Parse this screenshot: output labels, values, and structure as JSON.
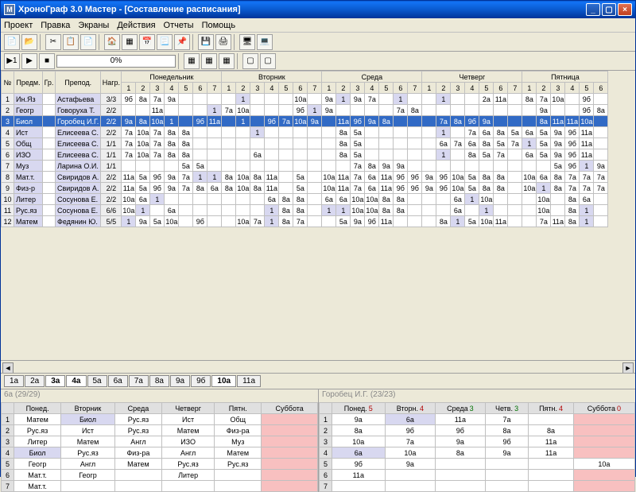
{
  "title": "ХроноГраф 3.0 Мастер - [Составление расписания]",
  "titleIcon": "M",
  "menu": [
    "Проект",
    "Правка",
    "Экраны",
    "Действия",
    "Отчеты",
    "Помощь"
  ],
  "progress": "0%",
  "columns": {
    "num": "№",
    "subj": "Предм.",
    "grp": "Гр.",
    "teach": "Препод.",
    "load": "Нагр."
  },
  "days": [
    "Понедельник",
    "Вторник",
    "Среда",
    "Четверг",
    "Пятница"
  ],
  "periods": {
    "mon": 7,
    "tue": 7,
    "wed": 7,
    "thu": 7,
    "fri": 6
  },
  "rows": [
    {
      "n": 1,
      "s": "Ин.Яз",
      "t": "Астафьева",
      "l": "3/3",
      "cells": {
        "m1": "9б",
        "m2": "8а",
        "m3": "7а",
        "m4": "9а",
        "v2": "1",
        "v6": "10а",
        "w1": "9а",
        "w2": "1",
        "w3": "9а",
        "w4": "7а",
        "w6": "1",
        "th2": "1",
        "th5": "2а",
        "th6": "11а",
        "f1": "8а",
        "f2": "7а",
        "f3": "10а",
        "f5": "9б"
      }
    },
    {
      "n": 2,
      "s": "Геогр",
      "t": "Говоруха Т.",
      "l": "2/2",
      "cells": {
        "m3": "11а",
        "m7": "1",
        "v1": "7а",
        "v2": "10а",
        "v6": "9б",
        "v7": "1",
        "w1": "9а",
        "w6": "7а",
        "w7": "8а",
        "f2": "9а",
        "f5": "9б",
        "f6": "8а"
      }
    },
    {
      "n": 3,
      "s": "Биол",
      "t": "Горобец И.Г.",
      "l": "2/2",
      "sel": true,
      "cells": {
        "m1": "9а",
        "m2": "8а",
        "m3": "10а",
        "m4": "1",
        "m6": "9б",
        "m7": "11а",
        "v2": "1",
        "v4": "9б",
        "v5": "7а",
        "v6": "10а",
        "v7": "9а",
        "w2": "11а",
        "w3": "9б",
        "w4": "9а",
        "w5": "8а",
        "th2": "7а",
        "th3": "8а",
        "th4": "9б",
        "th5": "9а",
        "f2": "8а",
        "f3": "11а",
        "f4": "11а",
        "f5": "10а"
      }
    },
    {
      "n": 4,
      "s": "Ист",
      "t": "Елисеева С.",
      "l": "2/2",
      "cells": {
        "m1": "7а",
        "m2": "10а",
        "m3": "7а",
        "m4": "8а",
        "m5": "8а",
        "v3": "1",
        "w2": "8а",
        "w3": "5а",
        "th2": "1",
        "th4": "7а",
        "th5": "6а",
        "th6": "8а",
        "th7": "5а",
        "f1": "6а",
        "f2": "5а",
        "f3": "9а",
        "f4": "9б",
        "f5": "11а"
      }
    },
    {
      "n": 5,
      "s": "Общ",
      "t": "Елисеева С.",
      "l": "1/1",
      "cells": {
        "m1": "7а",
        "m2": "10а",
        "m3": "7а",
        "m4": "8а",
        "m5": "8а",
        "w2": "8а",
        "w3": "5а",
        "th2": "6а",
        "th3": "7а",
        "th4": "6а",
        "th5": "8а",
        "th6": "5а",
        "th7": "7а",
        "f1": "1",
        "f2": "5а",
        "f3": "9а",
        "f4": "9б",
        "f5": "11а"
      }
    },
    {
      "n": 6,
      "s": "ИЗО",
      "t": "Елисеева С.",
      "l": "1/1",
      "cells": {
        "m1": "7а",
        "m2": "10а",
        "m3": "7а",
        "m4": "8а",
        "m5": "8а",
        "v3": "6а",
        "w2": "8а",
        "w3": "5а",
        "th2": "1",
        "th4": "8а",
        "th5": "5а",
        "th6": "7а",
        "f1": "6а",
        "f2": "5а",
        "f3": "9а",
        "f4": "9б",
        "f5": "11а"
      }
    },
    {
      "n": 7,
      "s": "Муз",
      "t": "Ларина О.И.",
      "l": "1/1",
      "cells": {
        "m5": "5а",
        "m6": "5а",
        "w3": "7а",
        "w4": "8а",
        "w5": "9а",
        "w6": "9а",
        "f3": "5а",
        "f4": "9б",
        "f5": "1",
        "f6": "9а"
      }
    },
    {
      "n": 8,
      "s": "Мат.т.",
      "t": "Свиридов А.",
      "l": "2/2",
      "cells": {
        "m1": "11а",
        "m2": "5а",
        "m3": "9б",
        "m4": "9а",
        "m5": "7а",
        "m6": "1",
        "m7": "1",
        "v1": "8а",
        "v2": "10а",
        "v3": "8а",
        "v4": "11а",
        "v6": "5а",
        "w1": "10а",
        "w2": "11а",
        "w3": "7а",
        "w4": "6а",
        "w5": "11а",
        "w6": "9б",
        "w7": "9б",
        "th1": "9а",
        "th2": "9б",
        "th3": "10а",
        "th4": "5а",
        "th5": "8а",
        "th6": "8а",
        "f1": "10а",
        "f2": "6а",
        "f3": "8а",
        "f4": "7а",
        "f5": "7а",
        "f6": "7а"
      }
    },
    {
      "n": 9,
      "s": "Физ-р",
      "t": "Свиридов А.",
      "l": "2/2",
      "cells": {
        "m1": "11а",
        "m2": "5а",
        "m3": "9б",
        "m4": "9а",
        "m5": "7а",
        "m6": "8а",
        "m7": "6а",
        "v1": "8а",
        "v2": "10а",
        "v3": "8а",
        "v4": "11а",
        "v6": "5а",
        "w1": "10а",
        "w2": "11а",
        "w3": "7а",
        "w4": "6а",
        "w5": "11а",
        "w6": "9б",
        "w7": "9б",
        "th1": "9а",
        "th2": "9б",
        "th3": "10а",
        "th4": "5а",
        "th5": "8а",
        "th6": "8а",
        "f1": "10а",
        "f2": "1",
        "f3": "8а",
        "f4": "7а",
        "f5": "7а",
        "f6": "7а"
      }
    },
    {
      "n": 10,
      "s": "Литер",
      "t": "Сосунова Е.",
      "l": "2/2",
      "cells": {
        "m1": "10а",
        "m2": "6а",
        "m3": "1",
        "v4": "6а",
        "v5": "8а",
        "v6": "8а",
        "w1": "6а",
        "w2": "6а",
        "w3": "10а",
        "w4": "10а",
        "w5": "8а",
        "w6": "8а",
        "th3": "6а",
        "th4": "1",
        "th5": "10а",
        "f2": "10а",
        "f4": "8а",
        "f5": "6а"
      }
    },
    {
      "n": 11,
      "s": "Рус.яз",
      "t": "Сосунова Е.",
      "l": "6/6",
      "cells": {
        "m1": "10а",
        "m2": "1",
        "m4": "6а",
        "v4": "1",
        "v5": "8а",
        "v6": "8а",
        "w1": "1",
        "w2": "1",
        "w3": "10а",
        "w4": "10а",
        "w5": "8а",
        "w6": "8а",
        "th3": "6а",
        "th5": "1",
        "f2": "10а",
        "f4": "8а",
        "f5": "1"
      }
    },
    {
      "n": 12,
      "s": "Матем",
      "t": "Федянин Ю.",
      "l": "5/5",
      "cells": {
        "m1": "1",
        "m2": "9а",
        "m3": "5а",
        "m4": "10а",
        "m6": "9б",
        "v2": "10а",
        "v3": "7а",
        "v4": "1",
        "v5": "8а",
        "v6": "7а",
        "w2": "5а",
        "w3": "9а",
        "w4": "9б",
        "w5": "11а",
        "th2": "8а",
        "th3": "1",
        "th4": "5а",
        "th5": "10а",
        "th6": "11а",
        "f2": "7а",
        "f3": "11а",
        "f4": "8а",
        "f5": "1"
      }
    }
  ],
  "tabs": [
    "1а",
    "2а",
    "3а",
    "4а",
    "5а",
    "6а",
    "7а",
    "8а",
    "9а",
    "9б",
    "10а",
    "11а"
  ],
  "activeTabs": [
    "3а",
    "4а",
    "10а"
  ],
  "leftPane": {
    "label": "6а (29/29)",
    "headers": [
      "Понед.",
      "Вторник",
      "Среда",
      "Четверг",
      "Пятн.",
      "Суббота"
    ],
    "rows": [
      {
        "n": "1",
        "c": [
          "Матем",
          "Биол",
          "Рус.яз",
          "Ист",
          "Общ",
          ""
        ]
      },
      {
        "n": "2",
        "c": [
          "Рус.яз",
          "Ист",
          "Рус.яз",
          "Матем",
          "Физ-ра",
          ""
        ]
      },
      {
        "n": "3",
        "c": [
          "Литер",
          "Матем",
          "Англ",
          "ИЗО",
          "Муз",
          ""
        ]
      },
      {
        "n": "4",
        "c": [
          "Биол",
          "Рус.яз",
          "Физ-ра",
          "Англ",
          "Матем",
          ""
        ]
      },
      {
        "n": "5",
        "c": [
          "Геогр",
          "Англ",
          "Матем",
          "Рус.яз",
          "Рус.яз",
          ""
        ]
      },
      {
        "n": "6",
        "c": [
          "Мат.т.",
          "Геогр",
          "",
          "Литер",
          "",
          ""
        ]
      },
      {
        "n": "7",
        "c": [
          "Мат.т.",
          "",
          "",
          "",
          "",
          ""
        ]
      }
    ]
  },
  "rightPane": {
    "label": "Горобец И.Г. (23/23)",
    "headers": [
      {
        "t": "Понед.",
        "n": "5"
      },
      {
        "t": "Вторн.",
        "n": "4"
      },
      {
        "t": "Среда",
        "n": "3",
        "g": true
      },
      {
        "t": "Четв.",
        "n": "3",
        "g": true
      },
      {
        "t": "Пятн.",
        "n": "4"
      },
      {
        "t": "Суббота",
        "n": "0"
      }
    ],
    "rows": [
      {
        "n": "1",
        "c": [
          "9а",
          "6а",
          "11а",
          "7а",
          "",
          ""
        ]
      },
      {
        "n": "2",
        "c": [
          "8а",
          "9б",
          "9б",
          "8а",
          "8а",
          ""
        ]
      },
      {
        "n": "3",
        "c": [
          "10а",
          "7а",
          "9а",
          "9б",
          "11а",
          ""
        ]
      },
      {
        "n": "4",
        "c": [
          "6а",
          "10а",
          "8а",
          "9а",
          "11а",
          ""
        ]
      },
      {
        "n": "5",
        "c": [
          "9б",
          "9а",
          "",
          "",
          "",
          "10а"
        ]
      },
      {
        "n": "6",
        "c": [
          "11а",
          "",
          "",
          "",
          "",
          ""
        ]
      },
      {
        "n": "7",
        "c": [
          "",
          "",
          "",
          "",
          "",
          ""
        ]
      }
    ]
  }
}
